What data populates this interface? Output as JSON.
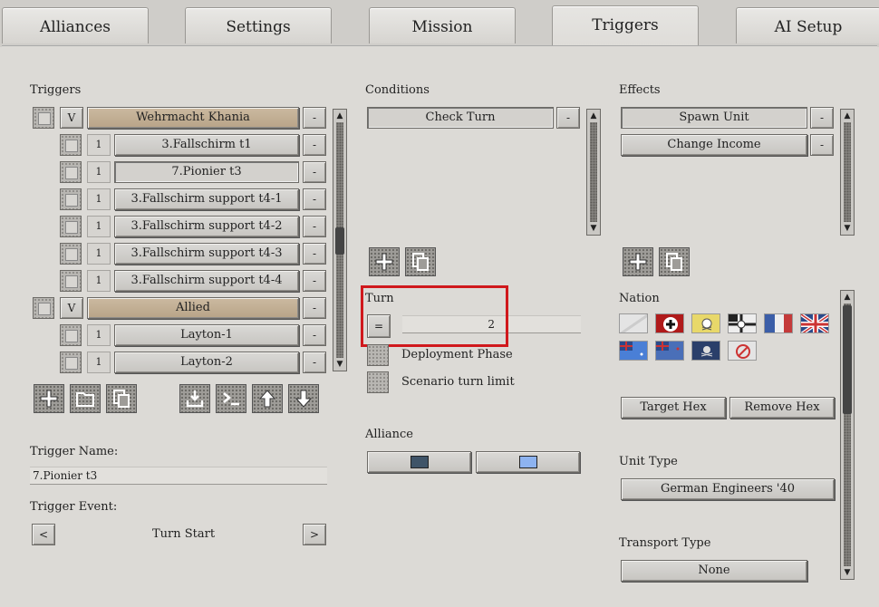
{
  "tabs": [
    {
      "label": "Alliances",
      "active": false
    },
    {
      "label": "Settings",
      "active": false
    },
    {
      "label": "Mission",
      "active": false
    },
    {
      "label": "Triggers",
      "active": true
    },
    {
      "label": "AI Setup",
      "active": false
    }
  ],
  "triggers": {
    "heading": "Triggers",
    "rows": [
      {
        "kind": "group",
        "marker": "V",
        "label": "Wehrmacht Khania"
      },
      {
        "kind": "item",
        "count": "1",
        "label": "3.Fallschirm t1"
      },
      {
        "kind": "item",
        "count": "1",
        "label": "7.Pionier t3",
        "selected": true
      },
      {
        "kind": "item",
        "count": "1",
        "label": "3.Fallschirm support t4-1"
      },
      {
        "kind": "item",
        "count": "1",
        "label": "3.Fallschirm support t4-2"
      },
      {
        "kind": "item",
        "count": "1",
        "label": "3.Fallschirm support t4-3"
      },
      {
        "kind": "item",
        "count": "1",
        "label": "3.Fallschirm support t4-4"
      },
      {
        "kind": "group",
        "marker": "V",
        "label": "Allied"
      },
      {
        "kind": "item",
        "count": "1",
        "label": "Layton-1"
      },
      {
        "kind": "item",
        "count": "1",
        "label": "Layton-2"
      }
    ],
    "remove_label": "-",
    "name_label": "Trigger Name:",
    "name_value": "7.Pionier t3",
    "event_label": "Trigger Event:",
    "event_value": "Turn Start",
    "prev": "<",
    "next": ">",
    "toolbar_icons": [
      "add-icon",
      "folder-icon",
      "copy-icon",
      "import-icon",
      "console-icon",
      "move-up-icon",
      "move-down-icon"
    ]
  },
  "conditions": {
    "heading": "Conditions",
    "items": [
      {
        "label": "Check Turn"
      }
    ],
    "remove_label": "-",
    "turn_label": "Turn",
    "operator": "=",
    "turn_value": "2",
    "deployment_label": "Deployment Phase",
    "limit_label": "Scenario turn limit",
    "alliance_label": "Alliance",
    "alliance_colors": [
      "#3f5468",
      "#8db3f0"
    ]
  },
  "effects": {
    "heading": "Effects",
    "items": [
      {
        "label": "Spawn Unit"
      },
      {
        "label": "Change Income"
      }
    ],
    "remove_label": "-",
    "nation_label": "Nation",
    "target_hex": "Target Hex",
    "remove_hex": "Remove Hex",
    "unit_type_label": "Unit Type",
    "unit_type_value": "German Engineers '40",
    "transport_label": "Transport Type",
    "transport_value": "None"
  }
}
